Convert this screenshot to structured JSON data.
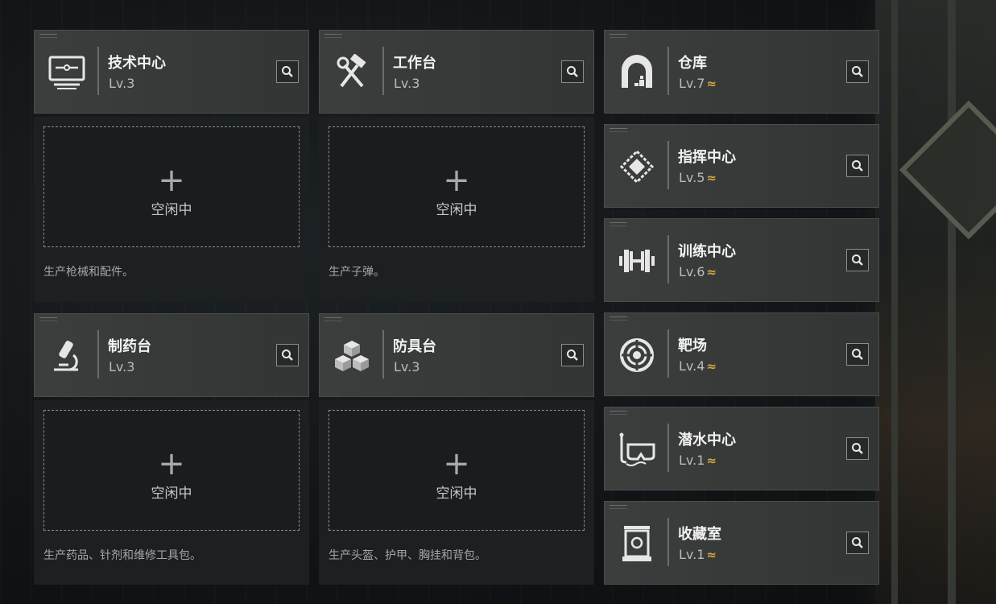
{
  "facilities_left": [
    {
      "name": "技术中心",
      "level": "Lv.3",
      "icon": "computer-icon"
    },
    {
      "name": "工作台",
      "level": "Lv.3",
      "icon": "hammer-wrench-icon"
    },
    {
      "name": "制药台",
      "level": "Lv.3",
      "icon": "microscope-icon"
    },
    {
      "name": "防具台",
      "level": "Lv.3",
      "icon": "cubes-icon"
    }
  ],
  "slots": [
    {
      "plus": "+",
      "status": "空闲中",
      "description": "生产枪械和配件。"
    },
    {
      "plus": "+",
      "status": "空闲中",
      "description": "生产子弹。"
    },
    {
      "plus": "+",
      "status": "空闲中",
      "description": "生产药品、针剂和维修工具包。"
    },
    {
      "plus": "+",
      "status": "空闲中",
      "description": "生产头盔、护甲、胸挂和背包。"
    }
  ],
  "facilities_right": [
    {
      "name": "仓库",
      "level": "Lv.7",
      "icon": "storage-arch-icon"
    },
    {
      "name": "指挥中心",
      "level": "Lv.5",
      "icon": "command-chip-icon"
    },
    {
      "name": "训练中心",
      "level": "Lv.6",
      "icon": "dumbbell-icon"
    },
    {
      "name": "靶场",
      "level": "Lv.4",
      "icon": "target-icon"
    },
    {
      "name": "潜水中心",
      "level": "Lv.1",
      "icon": "diving-mask-icon"
    },
    {
      "name": "收藏室",
      "level": "Lv.1",
      "icon": "display-case-icon"
    }
  ],
  "upgrade_indicator": "≈",
  "colors": {
    "accent_gold": "#d9a441",
    "card_bg": "#3b3e3d",
    "slot_bg": "#1d2022"
  }
}
